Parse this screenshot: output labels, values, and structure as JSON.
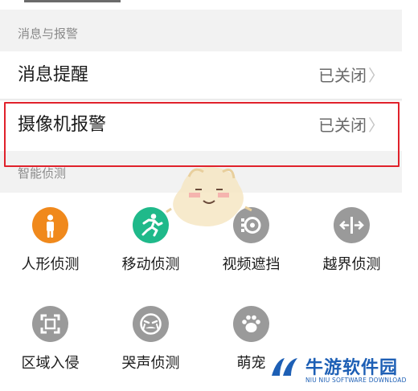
{
  "section_notifications": {
    "title": "消息与报警"
  },
  "rows": [
    {
      "label": "消息提醒",
      "status": "已关闭"
    },
    {
      "label": "摄像机报警",
      "status": "已关闭"
    }
  ],
  "section_detection": {
    "title": "智能侦测"
  },
  "detections": [
    {
      "label": "人形侦测",
      "icon": "person-icon",
      "color": "#f0891c"
    },
    {
      "label": "移动侦测",
      "icon": "running-person-icon",
      "color": "#1fb98a"
    },
    {
      "label": "视频遮挡",
      "icon": "video-block-icon",
      "color": "#9a9a9a"
    },
    {
      "label": "越界侦测",
      "icon": "boundary-cross-icon",
      "color": "#9a9a9a"
    },
    {
      "label": "区域入侵",
      "icon": "area-intrusion-icon",
      "color": "#9a9a9a"
    },
    {
      "label": "哭声侦测",
      "icon": "crying-face-icon",
      "color": "#9a9a9a"
    },
    {
      "label": "萌宠",
      "icon": "paw-icon",
      "color": "#9a9a9a"
    }
  ],
  "watermark": {
    "title": "牛游软件园",
    "subtitle": "NIU NIU SOFTWARE DOWNLOAD"
  },
  "colors": {
    "highlight": "#e0212b",
    "brand": "#1d5fb5"
  }
}
